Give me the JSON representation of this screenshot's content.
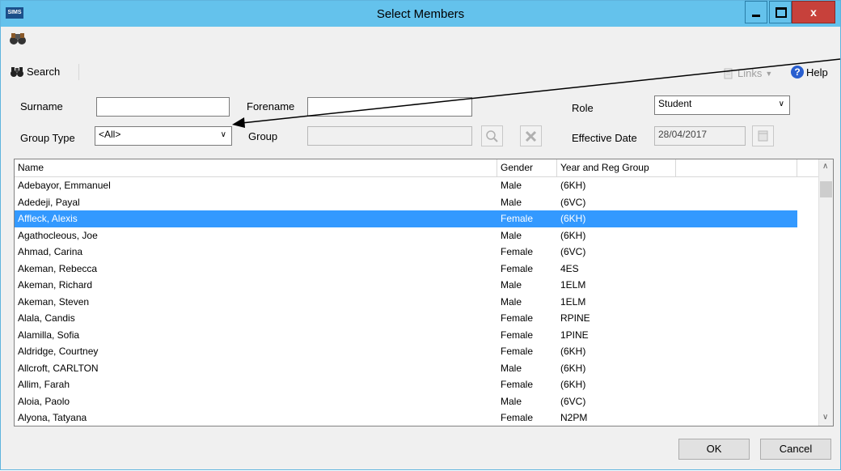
{
  "window": {
    "title": "Select Members",
    "app_icon_text": "SIMS",
    "close_label": "x"
  },
  "toolbar": {
    "search_label": "Search",
    "links_label": "Links",
    "help_label": "Help"
  },
  "form": {
    "surname_label": "Surname",
    "surname_value": "",
    "forename_label": "Forename",
    "forename_value": "",
    "role_label": "Role",
    "role_value": "Student",
    "group_type_label": "Group Type",
    "group_type_value": "<All>",
    "group_label": "Group",
    "group_value": "",
    "effective_date_label": "Effective Date",
    "effective_date_value": "28/04/2017"
  },
  "grid": {
    "columns": [
      "Name",
      "Gender",
      "Year and Reg Group"
    ],
    "selected_row": 2,
    "rows": [
      {
        "name": "Adebayor, Emmanuel",
        "gender": "Male",
        "group": "(6KH)"
      },
      {
        "name": "Adedeji, Payal",
        "gender": "Male",
        "group": "(6VC)"
      },
      {
        "name": "Affleck, Alexis",
        "gender": "Female",
        "group": "(6KH)"
      },
      {
        "name": "Agathocleous, Joe",
        "gender": "Male",
        "group": "(6KH)"
      },
      {
        "name": "Ahmad, Carina",
        "gender": "Female",
        "group": "(6VC)"
      },
      {
        "name": "Akeman, Rebecca",
        "gender": "Female",
        "group": "4ES"
      },
      {
        "name": "Akeman, Richard",
        "gender": "Male",
        "group": "1ELM"
      },
      {
        "name": "Akeman, Steven",
        "gender": "Male",
        "group": "1ELM"
      },
      {
        "name": "Alala, Candis",
        "gender": "Female",
        "group": "RPINE"
      },
      {
        "name": "Alamilla, Sofia",
        "gender": "Female",
        "group": "1PINE"
      },
      {
        "name": "Aldridge, Courtney",
        "gender": "Female",
        "group": "(6KH)"
      },
      {
        "name": "Allcroft, CARLTON",
        "gender": "Male",
        "group": "(6KH)"
      },
      {
        "name": "Allim, Farah",
        "gender": "Female",
        "group": "(6KH)"
      },
      {
        "name": "Aloia, Paolo",
        "gender": "Male",
        "group": "(6VC)"
      },
      {
        "name": "Alyona, Tatyana",
        "gender": "Female",
        "group": "N2PM"
      }
    ]
  },
  "buttons": {
    "ok": "OK",
    "cancel": "Cancel"
  },
  "colors": {
    "titlebar": "#64c2ec",
    "selection": "#3399ff",
    "close": "#c7413b"
  }
}
